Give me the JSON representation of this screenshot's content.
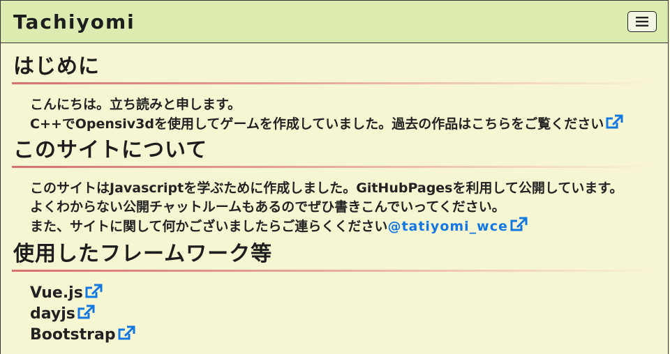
{
  "navbar": {
    "brand": "Tachiyomi",
    "toggle_icon": "hamburger-icon"
  },
  "sections": [
    {
      "title": "はじめに",
      "lines": [
        {
          "text": "こんにちは。立ち読みと申します。"
        },
        {
          "text": "C++でOpensiv3dを使用してゲームを作成していました。過去の作品はこちらをご覧ください",
          "icon": "external-link-icon"
        }
      ]
    },
    {
      "title": "このサイトについて",
      "lines": [
        {
          "text": "このサイトはJavascriptを学ぶために作成しました。GitHubPagesを利用して公開しています。"
        },
        {
          "text": "よくわからない公開チャットルームもあるのでぜひ書きこんでいってください。"
        },
        {
          "text": "また、サイトに関して何かございましたらご連らくください",
          "link": "@tatiyomi_wce",
          "icon": "external-link-icon"
        }
      ]
    },
    {
      "title": "使用したフレームワーク等",
      "items": [
        {
          "label": "Vue.js",
          "icon": "external-link-icon"
        },
        {
          "label": "dayjs",
          "icon": "external-link-icon"
        },
        {
          "label": "Bootstrap",
          "icon": "external-link-icon"
        }
      ]
    }
  ],
  "colors": {
    "background": "#f7f6d3",
    "navbar": "#dcebb0",
    "accent_rule": "#d9706f",
    "link": "#1277e0"
  }
}
